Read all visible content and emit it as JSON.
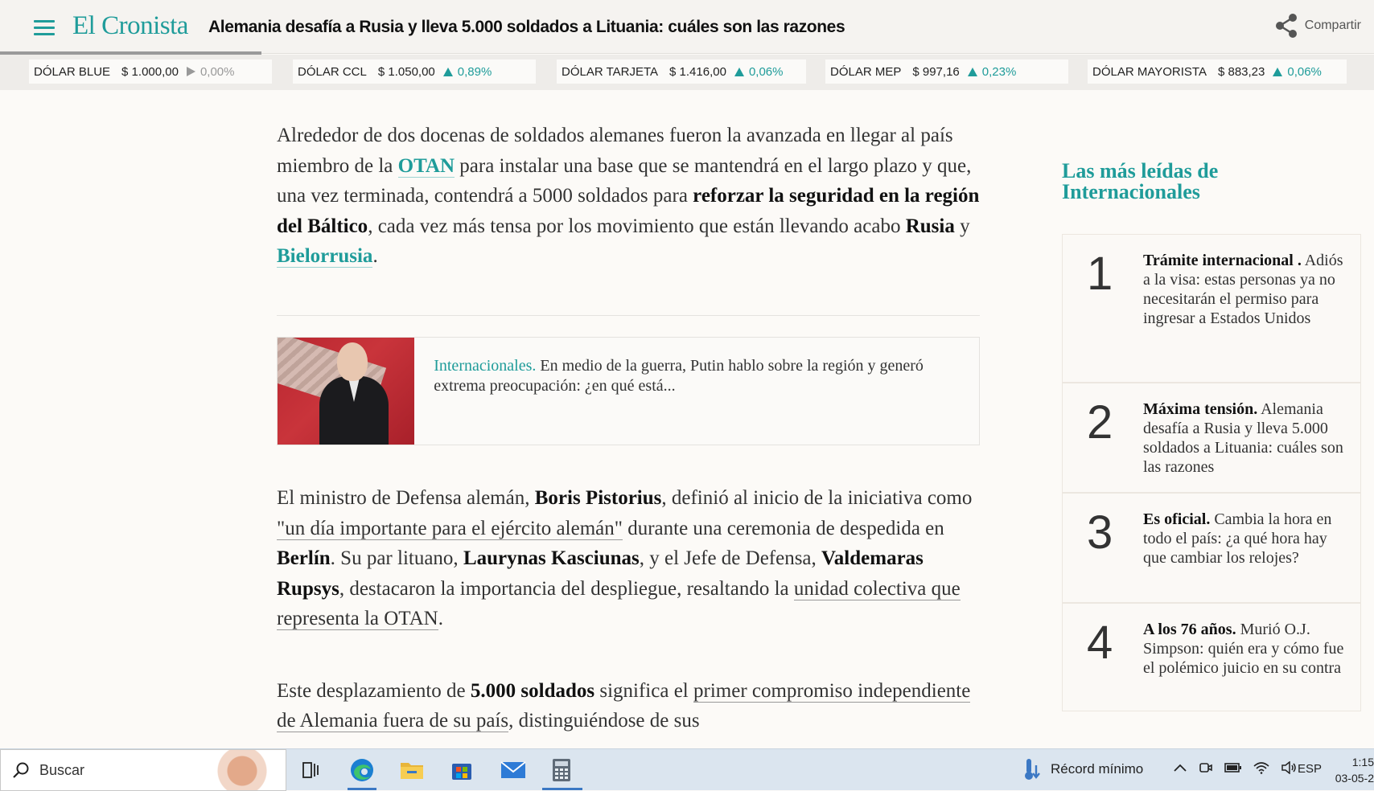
{
  "header": {
    "logo": "El Cronista",
    "headline": "Alemania desafía a Rusia y lleva 5.000 soldados a Lituania: cuáles son las razones",
    "share_label": "Compartir",
    "reading_progress": 0.19
  },
  "ticker": [
    {
      "name": "DÓLAR BLUE",
      "price": "$ 1.000,00",
      "change": "0,00%",
      "trend": "flat"
    },
    {
      "name": "DÓLAR CCL",
      "price": "$ 1.050,00",
      "change": "0,89%",
      "trend": "up"
    },
    {
      "name": "DÓLAR TARJETA",
      "price": "$ 1.416,00",
      "change": "0,06%",
      "trend": "up"
    },
    {
      "name": "DÓLAR MEP",
      "price": "$ 997,16",
      "change": "0,23%",
      "trend": "up"
    },
    {
      "name": "DÓLAR MAYORISTA",
      "price": "$ 883,23",
      "change": "0,06%",
      "trend": "up"
    }
  ],
  "article": {
    "p1": {
      "t1": "Alrededor de dos docenas de soldados alemanes fueron la avanzada en llegar al país miembro de la ",
      "link1": "OTAN",
      "t2": " para instalar una base que se mantendrá en el largo plazo y que, una vez terminada, contendrá a 5000 soldados para ",
      "b1": "reforzar la seguridad en la región del Báltico",
      "t3": ", cada vez más tensa por los movimiento que están llevando acabo ",
      "b2": "Rusia",
      "t4": " y ",
      "link2": "Bielorrusia",
      "t5": "."
    },
    "related": {
      "section": "Internacionales.",
      "text": " En medio de la guerra, Putin hablo sobre la región y generó extrema preocupación: ¿en qué está..."
    },
    "p2": {
      "t1": "El ministro de Defensa alemán, ",
      "b1": "Boris Pistorius",
      "t2": ", definió al inicio de la iniciativa como ",
      "u1": "\"un día importante para el ejército alemán\"",
      "t3": " durante una ceremonia de despedida en ",
      "b2": "Berlín",
      "t4": ". Su par lituano, ",
      "b3": "Laurynas Kasciunas",
      "t5": ", y el Jefe de Defensa, ",
      "b4": "Valdemaras Rupsys",
      "t6": ", destacaron la importancia del despliegue, resaltando la ",
      "u2": "unidad colectiva que representa la OTAN",
      "t7": "."
    },
    "p3": {
      "t1": "Este desplazamiento de ",
      "b1": "5.000 soldados",
      "t2": " significa el ",
      "u1": "primer compromiso independiente de Alemania fuera de su país",
      "t3": ", distinguiéndose de sus"
    }
  },
  "sidebar": {
    "title": "Las más leídas de Internacionales",
    "items": [
      {
        "num": "1",
        "bold": "Trámite internacional .",
        "text": " Adiós a la visa: estas personas ya no necesitarán el permiso para ingresar a Estados Unidos"
      },
      {
        "num": "2",
        "bold": "Máxima tensión.",
        "text": " Alemania desafía a Rusia y lleva 5.000 soldados a Lituania: cuáles son las razones"
      },
      {
        "num": "3",
        "bold": "Es oficial.",
        "text": " Cambia la hora en todo el país: ¿a qué hora hay que cambiar los relojes?"
      },
      {
        "num": "4",
        "bold": "A los 76 años.",
        "text": " Murió O.J. Simpson: quién era y cómo fue el polémico juicio en su contra"
      }
    ]
  },
  "taskbar": {
    "search_placeholder": "Buscar",
    "weather_label": "Récord mínimo",
    "language": "ESP",
    "time": "1:15",
    "date": "03-05-2",
    "apps": [
      "task-view-icon",
      "edge-icon",
      "file-explorer-icon",
      "store-icon",
      "mail-icon",
      "calculator-icon"
    ]
  },
  "colors": {
    "accent": "#1f9c9a",
    "background": "#fcfaf7",
    "text": "#333333"
  }
}
